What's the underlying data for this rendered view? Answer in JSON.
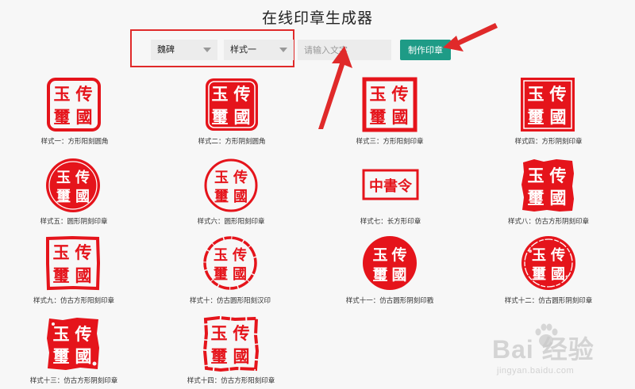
{
  "page": {
    "title": "在线印章生成器"
  },
  "controls": {
    "font_select": {
      "value": "魏碑"
    },
    "style_select": {
      "value": "样式一"
    },
    "text_input": {
      "placeholder": "请输入文字"
    },
    "make_button": {
      "label": "制作印章"
    }
  },
  "seal_chars": {
    "yu": "玉",
    "chuan": "传",
    "xi": "璽",
    "guo": "國",
    "long_text": "中書令"
  },
  "seals": [
    {
      "caption": "样式一：方形阳刻圆角"
    },
    {
      "caption": "样式二：方形阴刻圆角"
    },
    {
      "caption": "样式三：方形阳刻印章"
    },
    {
      "caption": "样式四：方形阴刻印章"
    },
    {
      "caption": "样式五：圆形阴刻印章"
    },
    {
      "caption": "样式六：圆形阳刻印章"
    },
    {
      "caption": "样式七：长方形印章"
    },
    {
      "caption": "样式八：仿古方形阴刻印章"
    },
    {
      "caption": "样式九：仿古方形阳刻印章"
    },
    {
      "caption": "样式十：仿古圆形阳刻汉印"
    },
    {
      "caption": "样式十一：仿古圆形阴刻印戳"
    },
    {
      "caption": "样式十二：仿古圆形阴刻印章"
    },
    {
      "caption": "样式十三：仿古方形阴刻印章"
    },
    {
      "caption": "样式十四：仿古方形阳刻印章"
    }
  ],
  "watermark": {
    "main": "Bai 经验",
    "sub": "jingyan.baidu.com"
  },
  "colors": {
    "seal_red": "#e5141b",
    "button": "#1e9b86",
    "highlight": "#e02a2a"
  }
}
